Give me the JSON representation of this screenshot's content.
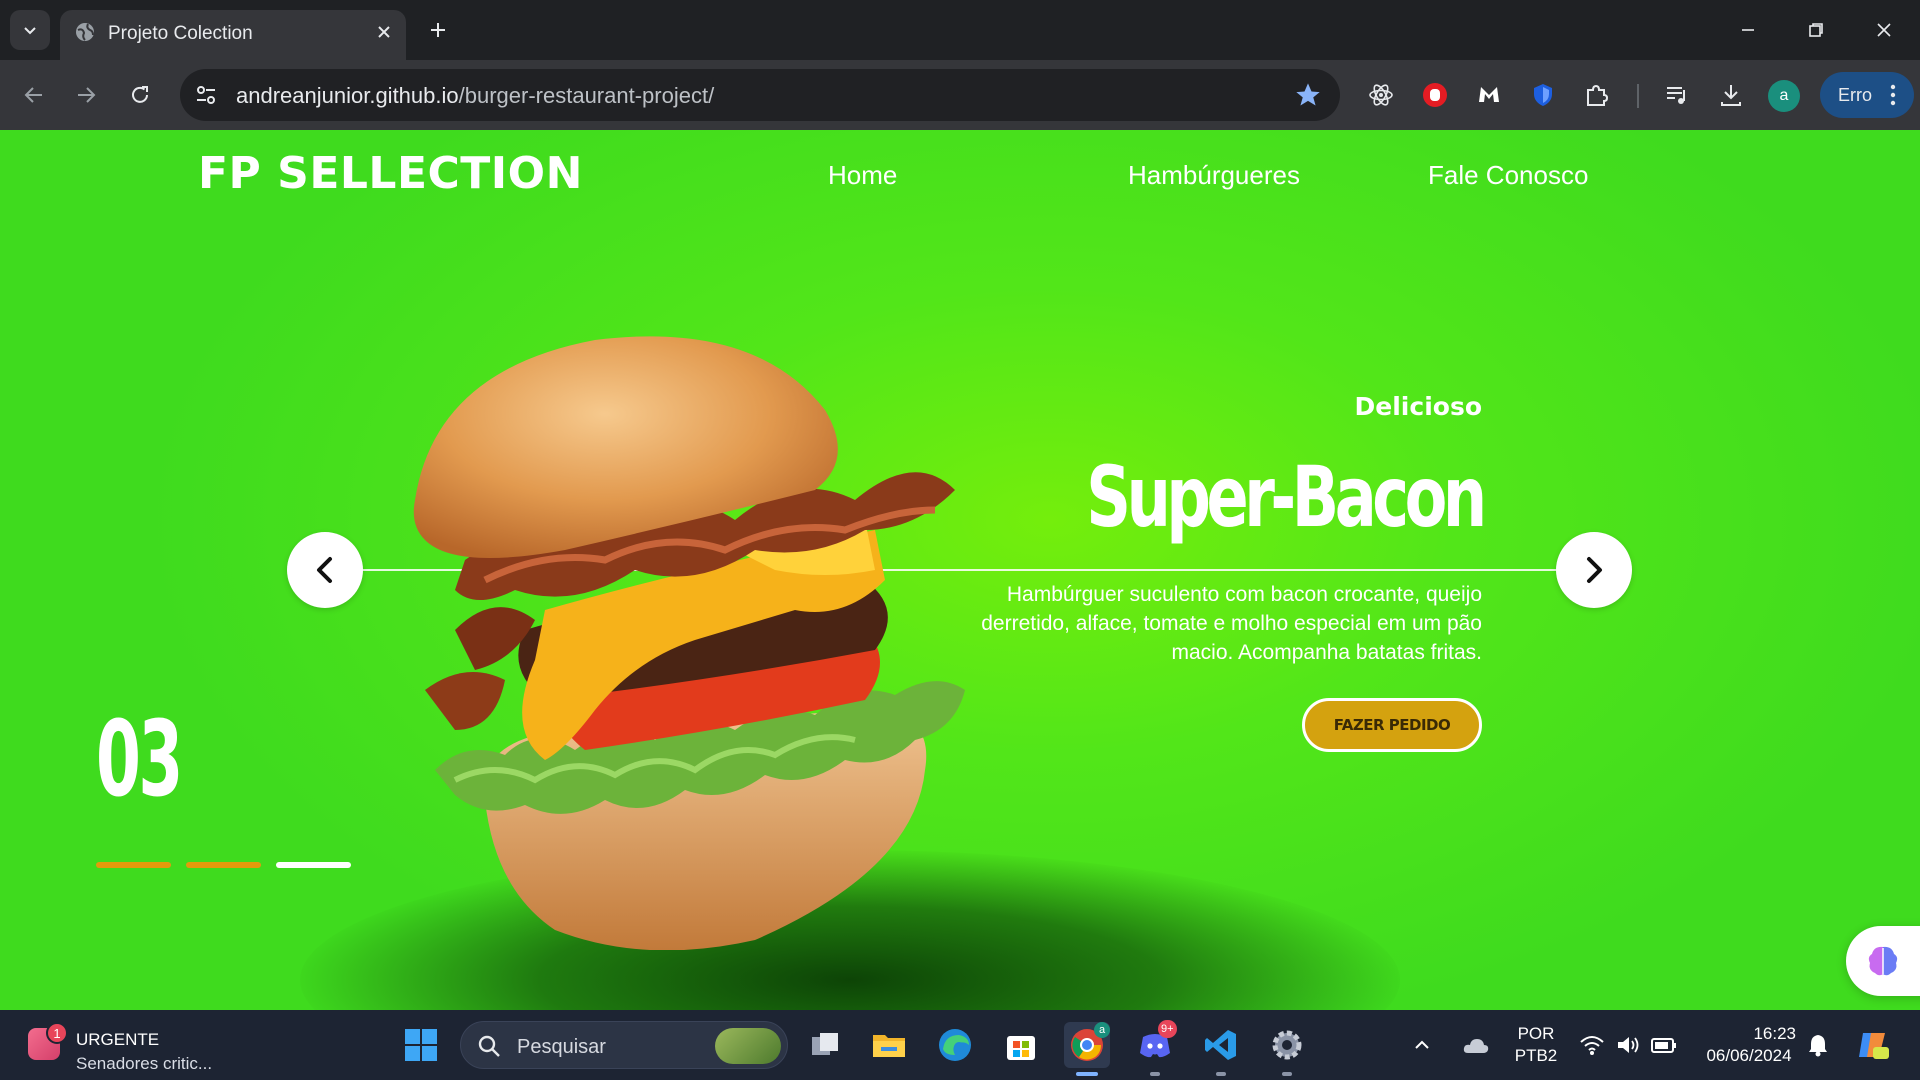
{
  "browser": {
    "tab_title": "Projeto Colection",
    "url_host": "andreanjunior.github.io",
    "url_path": "/burger-restaurant-project/",
    "profile_initial": "a",
    "error_label": "Erro"
  },
  "site": {
    "logo": "FP SELLECTION",
    "nav": [
      "Home",
      "Hambúrgueres",
      "Fale Conosco"
    ]
  },
  "hero": {
    "subtitle": "Delicioso",
    "title": "Super-Bacon",
    "description": "Hambúrguer suculento com bacon crocante, queijo derretido, alface, tomate e molho especial em um pão macio. Acompanha batatas fritas.",
    "cta": "FAZER PEDIDO",
    "slide_number": "03",
    "slides_total": 3,
    "active_slide": 3,
    "colors": {
      "background": "#52e619",
      "cta": "#d4a20f",
      "inactive_dot": "#e39a0c",
      "active_dot": "#ffffff"
    }
  },
  "taskbar": {
    "news_title": "URGENTE",
    "news_text": "Senadores critic...",
    "news_badge": "1",
    "search_placeholder": "Pesquisar",
    "discord_badge": "9+",
    "chrome_badge": "a",
    "lang_top": "POR",
    "lang_bottom": "PTB2",
    "time": "16:23",
    "date": "06/06/2024"
  }
}
